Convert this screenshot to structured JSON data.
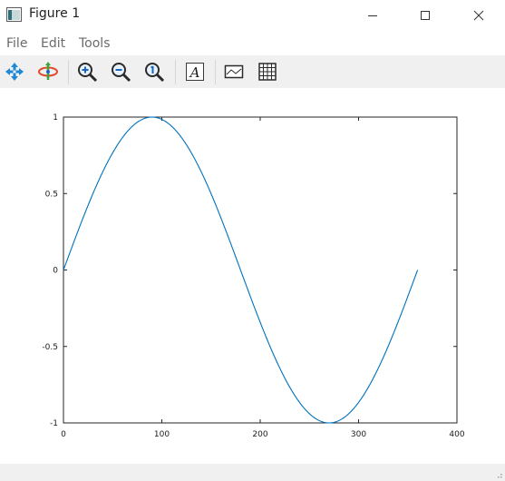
{
  "window": {
    "title": "Figure 1",
    "controls": [
      "minimize",
      "maximize",
      "close"
    ]
  },
  "menu": {
    "items": [
      {
        "label": "File"
      },
      {
        "label": "Edit"
      },
      {
        "label": "Tools"
      }
    ]
  },
  "toolbar": {
    "tools": [
      {
        "icon": "pan-icon"
      },
      {
        "icon": "rotate-icon"
      },
      {
        "icon": "zoom-in-icon"
      },
      {
        "icon": "zoom-out-icon"
      },
      {
        "icon": "zoom-reset-icon"
      },
      {
        "icon": "text-icon"
      },
      {
        "icon": "axes-toggle-icon"
      },
      {
        "icon": "grid-icon"
      }
    ]
  },
  "colors": {
    "line": "#0072bd",
    "axes": "#262626",
    "toolbar_bg": "#f0f0f0"
  },
  "chart_data": {
    "type": "line",
    "title": "",
    "xlabel": "",
    "ylabel": "",
    "xlim": [
      0,
      400
    ],
    "ylim": [
      -1,
      1
    ],
    "xticks": [
      0,
      100,
      200,
      300,
      400
    ],
    "yticks": [
      -1,
      -0.5,
      0,
      0.5,
      1
    ],
    "xtick_labels": [
      "0",
      "100",
      "200",
      "300",
      "400"
    ],
    "ytick_labels": [
      "-1",
      "-0.5",
      "0",
      "0.5",
      "1"
    ],
    "grid": false,
    "series": [
      {
        "x_range": [
          0,
          360
        ],
        "function": "sin(x degrees)",
        "x": [
          0,
          15,
          30,
          45,
          60,
          75,
          90,
          105,
          120,
          135,
          150,
          165,
          180,
          195,
          210,
          225,
          240,
          255,
          270,
          285,
          300,
          315,
          330,
          345,
          360
        ],
        "y": [
          0,
          0.259,
          0.5,
          0.707,
          0.866,
          0.966,
          1,
          0.966,
          0.866,
          0.707,
          0.5,
          0.259,
          0,
          -0.259,
          -0.5,
          -0.707,
          -0.866,
          -0.966,
          -1,
          -0.966,
          -0.866,
          -0.707,
          -0.5,
          -0.259,
          0
        ]
      }
    ]
  }
}
